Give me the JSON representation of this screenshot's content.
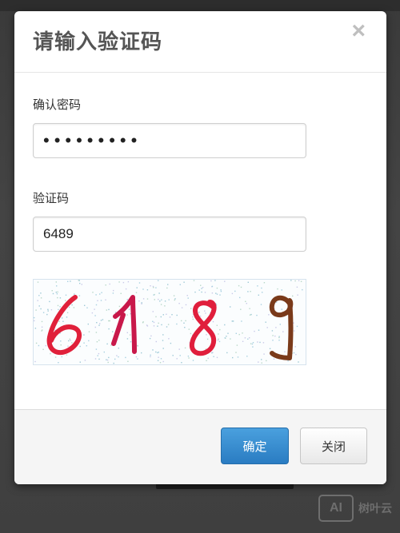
{
  "dialog": {
    "title": "请输入验证码",
    "close_glyph": "×"
  },
  "form": {
    "password_label": "确认密码",
    "password_value": "•••••••••",
    "captcha_label": "验证码",
    "captcha_value": "6489"
  },
  "captcha_image": {
    "text": "6189",
    "digit_colors": [
      "#e0203a",
      "#c8184a",
      "#e01e3c",
      "#7a3a1a"
    ]
  },
  "footer": {
    "confirm_label": "确定",
    "close_label": "关闭"
  },
  "watermark": {
    "badge": "AI",
    "text": "树叶云"
  },
  "colors": {
    "primary_button": "#2a7cc2",
    "backdrop": "#444444"
  }
}
